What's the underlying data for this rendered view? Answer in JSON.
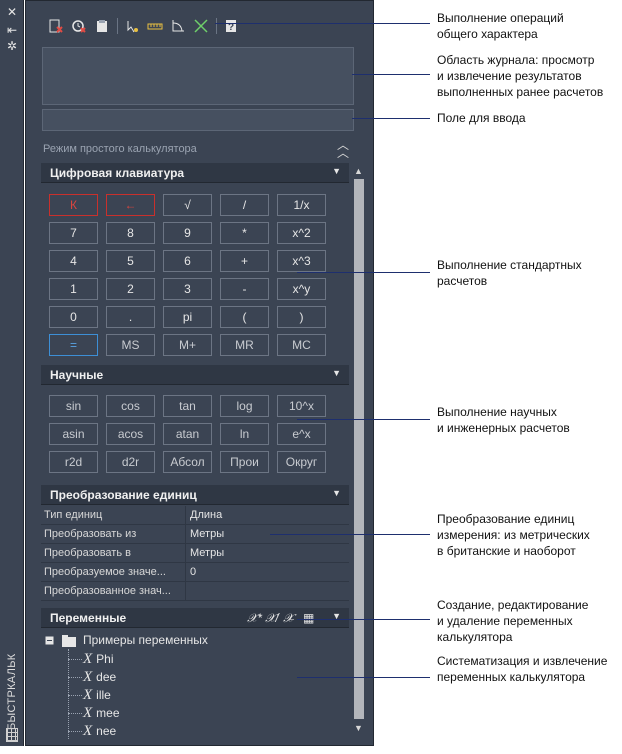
{
  "window": {
    "strip_title": "БЫСТРКАЛЬК",
    "close_icon": "close-icon",
    "autohide_icon": "autohide-icon",
    "settings_icon": "settings-icon"
  },
  "toolbar": {
    "items": [
      "clear-icon",
      "clear-history-icon",
      "paste-value-icon",
      "get-coordinates-icon",
      "distance-icon",
      "angle-icon",
      "intersection-icon",
      "help-icon"
    ]
  },
  "input": {
    "value": ""
  },
  "mode_label": "Режим простого калькулятора",
  "keypad": {
    "title": "Цифровая клавиатура",
    "rows": [
      [
        "К",
        "←",
        "√",
        "/",
        "1/x"
      ],
      [
        "7",
        "8",
        "9",
        "*",
        "x^2"
      ],
      [
        "4",
        "5",
        "6",
        "+",
        "x^3"
      ],
      [
        "1",
        "2",
        "3",
        "-",
        "x^y"
      ],
      [
        "0",
        ".",
        "pi",
        "(",
        ")"
      ],
      [
        "=",
        "MS",
        "M+",
        "MR",
        "MC"
      ]
    ]
  },
  "scientific": {
    "title": "Научные",
    "rows": [
      [
        "sin",
        "cos",
        "tan",
        "log",
        "10^x"
      ],
      [
        "asin",
        "acos",
        "atan",
        "ln",
        "e^x"
      ],
      [
        "r2d",
        "d2r",
        "Абсол",
        "Прои",
        "Округ"
      ]
    ]
  },
  "units": {
    "title": "Преобразование единиц",
    "rows": [
      {
        "name": "Тип единиц",
        "value": "Длина"
      },
      {
        "name": "Преобразовать из",
        "value": "Метры"
      },
      {
        "name": "Преобразовать в",
        "value": "Метры"
      },
      {
        "name": "Преобразуемое значе...",
        "value": "0"
      },
      {
        "name": "Преобразованное знач...",
        "value": ""
      }
    ]
  },
  "variables": {
    "title": "Переменные",
    "group": "Примеры переменных",
    "items": [
      "Phi",
      "dee",
      "ille",
      "mee",
      "nee"
    ]
  },
  "callouts": [
    "Выполнение операций\nобщего характера",
    "Область журнала: просмотр\nи извлечение результатов\nвыполненных ранее расчетов",
    "Поле для ввода",
    "Выполнение стандартных\nрасчетов",
    "Выполнение научных\nи инженерных расчетов",
    "Преобразование единиц\nизмерения: из метрических\nв британские и наоборот",
    "Создание, редактирование\nи удаление переменных\nкалькулятора",
    "Систематизация и извлечение\nпеременных калькулятора"
  ]
}
